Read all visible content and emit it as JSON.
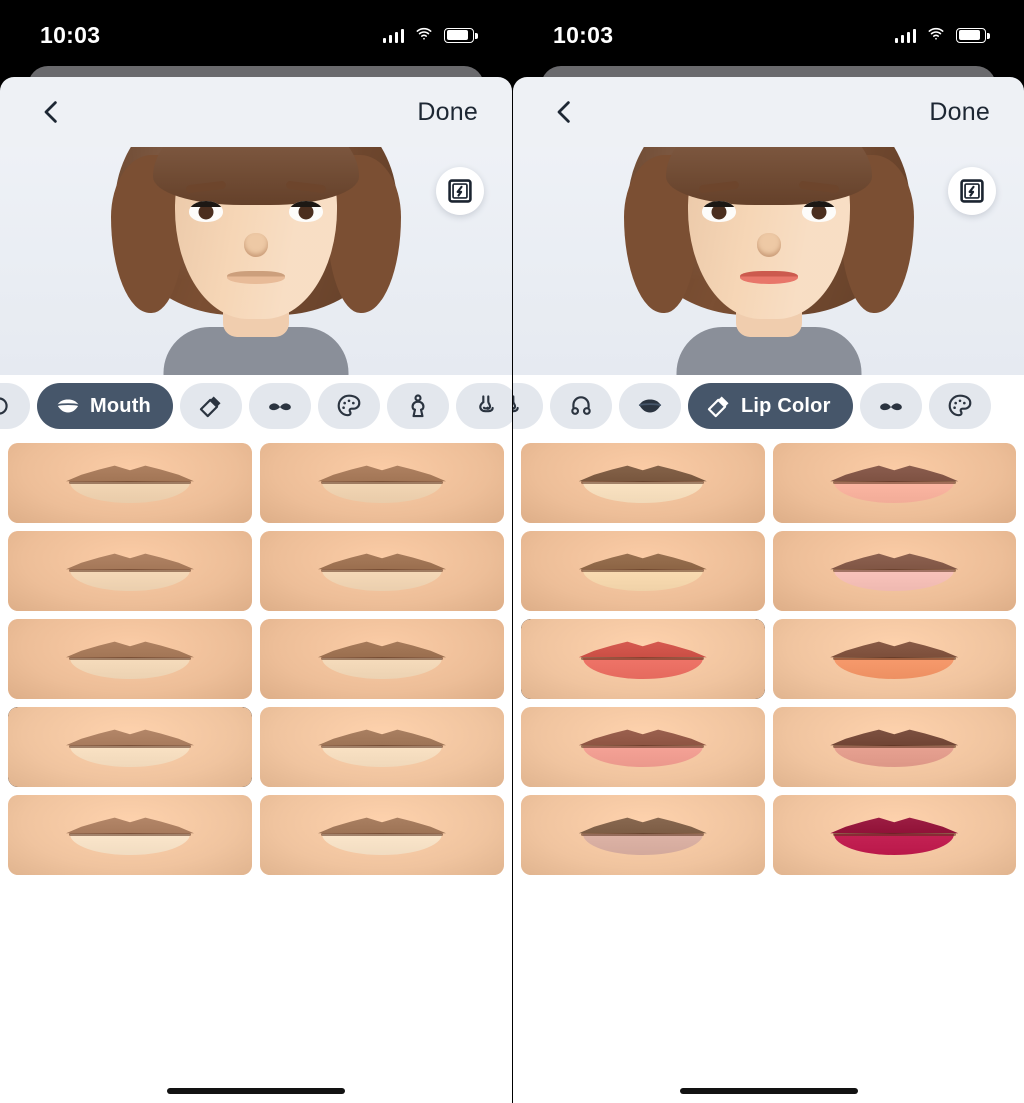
{
  "panels": [
    {
      "id": "left",
      "status": {
        "time": "10:03",
        "signal_icon": "cellular-signal-icon",
        "wifi_icon": "wifi-icon",
        "battery_icon": "battery-icon"
      },
      "nav": {
        "back_icon": "chevron-left-icon",
        "done_label": "Done"
      },
      "randomize": {
        "icon": "shuffle-frame-icon"
      },
      "avatar": {
        "hair_color": "#7b4f33",
        "skin_color": "#f6d6b6",
        "eye_color": "#4b2e1e",
        "shirt_color": "#8a8f99",
        "lip_color": "#e8bb98"
      },
      "tabs": [
        {
          "label": "",
          "icon": "partial-icon",
          "selected": false,
          "icon_only": true,
          "clipped": "left"
        },
        {
          "label": "Mouth",
          "icon": "lips-icon",
          "selected": true,
          "icon_only": false
        },
        {
          "label": "",
          "icon": "lipstick-icon",
          "selected": false,
          "icon_only": true
        },
        {
          "label": "",
          "icon": "mustache-icon",
          "selected": false,
          "icon_only": true
        },
        {
          "label": "",
          "icon": "palette-icon",
          "selected": false,
          "icon_only": true
        },
        {
          "label": "",
          "icon": "body-icon",
          "selected": false,
          "icon_only": true
        },
        {
          "label": "",
          "icon": "nose-icon",
          "selected": false,
          "icon_only": true,
          "clipped": "right"
        }
      ],
      "grid": {
        "selected_index": 6,
        "cells": [
          {
            "name": "mouth-option-1",
            "skin": "#edbe98",
            "lip_top": "#b08363",
            "lip_bottom": "#f3d6b4",
            "shape": "thin-flat"
          },
          {
            "name": "mouth-option-2",
            "skin": "#edbe98",
            "lip_top": "#b08363",
            "lip_bottom": "#f3d6b4",
            "shape": "thin-wide"
          },
          {
            "name": "mouth-option-3",
            "skin": "#edbe98",
            "lip_top": "#b28566",
            "lip_bottom": "#f5d9b8",
            "shape": "cupid-small"
          },
          {
            "name": "mouth-option-4",
            "skin": "#edbe98",
            "lip_top": "#a87c5c",
            "lip_bottom": "#f5d9b8",
            "shape": "cupid-full"
          },
          {
            "name": "mouth-option-5",
            "skin": "#edbe98",
            "lip_top": "#b08363",
            "lip_bottom": "#f6dcbc",
            "shape": "cupid-medium"
          },
          {
            "name": "mouth-option-6",
            "skin": "#edbe98",
            "lip_top": "#a87c5c",
            "lip_bottom": "#f6dcbc",
            "shape": "cupid-full-2"
          },
          {
            "name": "mouth-option-7",
            "skin": "#f0c49f",
            "lip_top": "#b5886a",
            "lip_bottom": "#fae2c4",
            "shape": "cupid-selected"
          },
          {
            "name": "mouth-option-8",
            "skin": "#f0c49f",
            "lip_top": "#ab8163",
            "lip_bottom": "#fae2c4",
            "shape": "cupid-wide"
          },
          {
            "name": "mouth-option-9",
            "skin": "#f0c49f",
            "lip_top": "#b5886a",
            "lip_bottom": "#fbe6cb",
            "shape": "cupid-soft"
          },
          {
            "name": "mouth-option-10",
            "skin": "#f0c49f",
            "lip_top": "#ab8163",
            "lip_bottom": "#fbe6cb",
            "shape": "cupid-soft-2"
          }
        ]
      },
      "home_indicator": true
    },
    {
      "id": "right",
      "status": {
        "time": "10:03",
        "signal_icon": "cellular-signal-icon",
        "wifi_icon": "wifi-icon",
        "battery_icon": "battery-icon"
      },
      "nav": {
        "back_icon": "chevron-left-icon",
        "done_label": "Done"
      },
      "randomize": {
        "icon": "shuffle-frame-icon"
      },
      "avatar": {
        "hair_color": "#7b4f33",
        "skin_color": "#f6d6b6",
        "eye_color": "#4b2e1e",
        "shirt_color": "#8a8f99",
        "lip_color": "#e8766a"
      },
      "tabs": [
        {
          "label": "",
          "icon": "nose-icon",
          "selected": false,
          "icon_only": true,
          "clipped": "left"
        },
        {
          "label": "",
          "icon": "earrings-icon",
          "selected": false,
          "icon_only": true
        },
        {
          "label": "",
          "icon": "lips-icon",
          "selected": false,
          "icon_only": true
        },
        {
          "label": "Lip Color",
          "icon": "lipstick-icon",
          "selected": true,
          "icon_only": false
        },
        {
          "label": "",
          "icon": "mustache-icon",
          "selected": false,
          "icon_only": true
        },
        {
          "label": "",
          "icon": "palette-icon",
          "selected": false,
          "icon_only": true,
          "clipped": "right"
        }
      ],
      "grid": {
        "selected_index": 4,
        "cells": [
          {
            "name": "lip-color-option-1",
            "skin": "#edbe98",
            "lip_top": "#86644b",
            "lip_bottom": "#fbe3c2",
            "shape": "natural"
          },
          {
            "name": "lip-color-option-2",
            "skin": "#edbe98",
            "lip_top": "#8c5f50",
            "lip_bottom": "#fcb6a2",
            "shape": "pink-peach"
          },
          {
            "name": "lip-color-option-3",
            "skin": "#edbe98",
            "lip_top": "#9a7252",
            "lip_bottom": "#fadcb2",
            "shape": "nude"
          },
          {
            "name": "lip-color-option-4",
            "skin": "#edbe98",
            "lip_top": "#8e6352",
            "lip_bottom": "#f9c3bb",
            "shape": "light-pink"
          },
          {
            "name": "lip-color-option-5",
            "skin": "#f0c49f",
            "lip_top": "#d85c52",
            "lip_bottom": "#ef7468",
            "shape": "coral-selected"
          },
          {
            "name": "lip-color-option-6",
            "skin": "#f0c49f",
            "lip_top": "#8a5c48",
            "lip_bottom": "#f79a6c",
            "shape": "apricot"
          },
          {
            "name": "lip-color-option-7",
            "skin": "#f0c49f",
            "lip_top": "#9c6250",
            "lip_bottom": "#f5a296",
            "shape": "salmon"
          },
          {
            "name": "lip-color-option-8",
            "skin": "#f0c49f",
            "lip_top": "#7e5242",
            "lip_bottom": "#e7a191",
            "shape": "dusty-rose"
          },
          {
            "name": "lip-color-option-9",
            "skin": "#f0c49f",
            "lip_top": "#8a6a52",
            "lip_bottom": "#ddb3a6",
            "shape": "mauve"
          },
          {
            "name": "lip-color-option-10",
            "skin": "#f0c49f",
            "lip_top": "#9e1f45",
            "lip_bottom": "#c42254",
            "shape": "berry"
          }
        ]
      },
      "home_indicator": true
    }
  ],
  "theme": {
    "selected_tab_bg": "#46566a",
    "tab_bg": "#e3e7ed",
    "screen_bg": "#eef1f5",
    "selection_border": "#1c2b3a",
    "text_dark": "#1d2733"
  }
}
